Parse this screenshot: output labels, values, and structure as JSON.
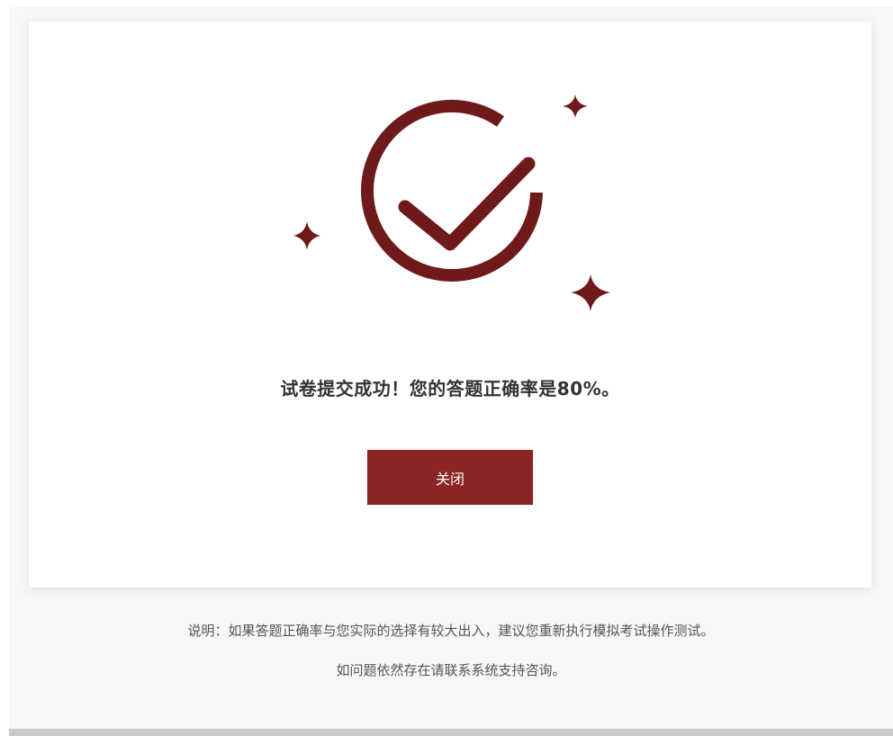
{
  "dialog": {
    "message": "试卷提交成功！您的答题正确率是80%。",
    "close_label": "关闭",
    "score_percent": 80
  },
  "note": {
    "line1": "说明：如果答题正确率与您实际的选择有较大出入，建议您重新执行模拟考试操作测试。",
    "line2": "如问题依然存在请联系系统支持咨询。"
  },
  "icons": {
    "success": "check-circle-icon",
    "decoration": "sparkle-icon"
  },
  "colors": {
    "accent": "#8b2424",
    "icon": "#6e1a1a",
    "text": "#333333",
    "note_text": "#555555",
    "background": "#f7f7f7"
  }
}
